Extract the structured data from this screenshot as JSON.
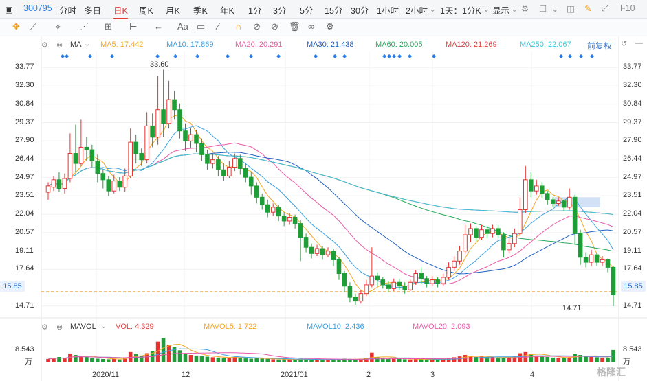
{
  "toolbar": {
    "code": "300795",
    "periods": [
      "分时",
      "多日",
      "日K",
      "周K",
      "月K",
      "季K",
      "年K",
      "1分",
      "3分",
      "5分",
      "15分",
      "30分",
      "1小时",
      "2小时"
    ],
    "active_period": "日K",
    "range_select": "1天：1分K",
    "display": "显示",
    "f10": "F10"
  },
  "drawtools": [
    "✥",
    "⟋",
    "⟡",
    "⋰",
    "⊞",
    "⊢",
    "←",
    "Aa",
    "▭",
    "∕",
    "∩",
    "⊘",
    "⊘",
    "🗑",
    "∞",
    "⚙"
  ],
  "ma_bar": {
    "label": "MA",
    "items": [
      {
        "text": "MA5: 17.442",
        "color": "#f5a623"
      },
      {
        "text": "MA10: 17.869",
        "color": "#3aa0e0"
      },
      {
        "text": "MA20: 20.291",
        "color": "#e85aa8"
      },
      {
        "text": "MA30: 21.438",
        "color": "#2060c0"
      },
      {
        "text": "MA60: 20.005",
        "color": "#27a85a"
      },
      {
        "text": "MA120: 21.269",
        "color": "#e04040"
      },
      {
        "text": "MA250: 22.067",
        "color": "#38c8e0"
      }
    ],
    "adjust": "前复权"
  },
  "price_axis": {
    "ticks": [
      "33.77",
      "32.30",
      "30.84",
      "29.37",
      "27.90",
      "26.44",
      "24.97",
      "23.51",
      "22.04",
      "20.57",
      "19.11",
      "17.64",
      "15.85",
      "14.71"
    ],
    "current": "15.85",
    "high_label": "33.60",
    "low_label": "14.71"
  },
  "date_axis": [
    "2020/11",
    "12",
    "2021/01",
    "2",
    "3",
    "4"
  ],
  "vol_bar": {
    "label": "MAVOL",
    "items": [
      {
        "text": "VOL: 4.329",
        "color": "#e04040"
      },
      {
        "text": "MAVOL5: 1.722",
        "color": "#f5a623"
      },
      {
        "text": "MAVOL10: 2.436",
        "color": "#3aa0e0"
      },
      {
        "text": "MAVOL20: 2.093",
        "color": "#e85aa8"
      }
    ],
    "max": "8.543",
    "unit": "万"
  },
  "watermark": "格隆汇",
  "chart_data": {
    "type": "candlestick",
    "ylim": [
      14.2,
      34.5
    ],
    "candles": [
      [
        23.8,
        24.3,
        23.2,
        24.6
      ],
      [
        24.2,
        24.8,
        23.9,
        25.1
      ],
      [
        24.8,
        24.1,
        23.8,
        25.4
      ],
      [
        24.1,
        24.9,
        23.7,
        25.3
      ],
      [
        24.9,
        26.9,
        24.6,
        28.5
      ],
      [
        26.9,
        26.1,
        25.4,
        29.2
      ],
      [
        26.1,
        27.4,
        25.9,
        29.6
      ],
      [
        27.4,
        27.2,
        26.3,
        28.2
      ],
      [
        27.2,
        26.3,
        25.8,
        27.6
      ],
      [
        26.3,
        25.3,
        24.6,
        26.8
      ],
      [
        25.3,
        24.8,
        24.1,
        25.6
      ],
      [
        24.8,
        23.9,
        23.5,
        25.1
      ],
      [
        23.9,
        24.7,
        23.7,
        25.2
      ],
      [
        24.7,
        24.2,
        23.9,
        25.0
      ],
      [
        24.2,
        25.1,
        23.8,
        25.7
      ],
      [
        25.1,
        27.8,
        24.9,
        28.9
      ],
      [
        27.8,
        26.9,
        26.1,
        28.4
      ],
      [
        26.9,
        26.4,
        25.9,
        27.3
      ],
      [
        26.4,
        29.1,
        26.1,
        30.2
      ],
      [
        29.1,
        28.2,
        27.4,
        30.1
      ],
      [
        28.2,
        30.4,
        27.6,
        33.1
      ],
      [
        30.4,
        29.3,
        28.2,
        33.6
      ],
      [
        29.3,
        31.2,
        28.9,
        32.7
      ],
      [
        31.2,
        30.4,
        29.6,
        31.9
      ],
      [
        30.4,
        28.7,
        28.1,
        30.9
      ],
      [
        28.7,
        27.9,
        27.1,
        29.3
      ],
      [
        27.9,
        28.4,
        27.3,
        28.9
      ],
      [
        28.4,
        27.7,
        27.0,
        28.8
      ],
      [
        27.7,
        26.8,
        26.3,
        28.1
      ],
      [
        26.8,
        26.1,
        25.6,
        27.2
      ],
      [
        26.1,
        26.4,
        25.7,
        26.9
      ],
      [
        26.4,
        25.6,
        25.1,
        26.7
      ],
      [
        25.6,
        25.1,
        24.7,
        26.1
      ],
      [
        25.1,
        25.8,
        24.9,
        26.3
      ],
      [
        25.8,
        26.5,
        25.5,
        26.9
      ],
      [
        26.5,
        25.7,
        25.2,
        26.8
      ],
      [
        25.7,
        25.0,
        24.6,
        26.1
      ],
      [
        25.0,
        24.3,
        23.6,
        25.4
      ],
      [
        24.3,
        23.4,
        22.9,
        24.6
      ],
      [
        23.4,
        22.8,
        22.4,
        23.7
      ],
      [
        22.8,
        22.2,
        21.8,
        23.2
      ],
      [
        22.2,
        22.6,
        21.9,
        22.9
      ],
      [
        22.6,
        21.9,
        21.5,
        22.8
      ],
      [
        21.9,
        21.5,
        21.1,
        22.2
      ],
      [
        21.5,
        21.8,
        21.2,
        22.1
      ],
      [
        21.8,
        21.3,
        20.9,
        22.0
      ],
      [
        21.3,
        20.2,
        18.3,
        21.6
      ],
      [
        20.2,
        19.4,
        19.0,
        20.5
      ],
      [
        19.4,
        18.9,
        18.5,
        19.7
      ],
      [
        18.9,
        19.3,
        18.7,
        19.6
      ],
      [
        19.3,
        18.8,
        18.4,
        19.5
      ],
      [
        18.8,
        19.1,
        18.6,
        19.4
      ],
      [
        19.1,
        18.4,
        17.9,
        19.3
      ],
      [
        18.4,
        17.3,
        16.8,
        18.6
      ],
      [
        17.3,
        16.3,
        15.8,
        17.5
      ],
      [
        16.3,
        15.4,
        15.0,
        16.6
      ],
      [
        15.4,
        15.1,
        14.8,
        15.7
      ],
      [
        15.1,
        15.7,
        14.9,
        16.0
      ],
      [
        15.7,
        16.4,
        15.5,
        16.8
      ],
      [
        16.4,
        17.1,
        16.2,
        19.4
      ],
      [
        17.1,
        16.8,
        16.3,
        17.4
      ],
      [
        16.8,
        16.4,
        16.1,
        17.0
      ],
      [
        16.4,
        16.1,
        15.8,
        16.7
      ],
      [
        16.1,
        16.6,
        15.9,
        16.9
      ],
      [
        16.6,
        16.3,
        16.0,
        16.9
      ],
      [
        16.3,
        16.0,
        15.7,
        16.6
      ],
      [
        16.0,
        16.6,
        15.9,
        16.8
      ],
      [
        16.6,
        17.3,
        16.4,
        17.6
      ],
      [
        17.3,
        16.9,
        16.5,
        17.8
      ],
      [
        16.9,
        16.5,
        16.2,
        17.1
      ],
      [
        16.5,
        16.8,
        16.3,
        17.1
      ],
      [
        16.8,
        16.5,
        16.2,
        17.0
      ],
      [
        16.5,
        17.0,
        16.3,
        17.3
      ],
      [
        17.0,
        17.8,
        16.8,
        18.2
      ],
      [
        17.8,
        18.3,
        17.5,
        18.7
      ],
      [
        18.3,
        19.1,
        18.0,
        19.5
      ],
      [
        19.1,
        20.4,
        18.9,
        21.2
      ],
      [
        20.4,
        20.9,
        19.8,
        21.3
      ],
      [
        20.9,
        20.2,
        19.9,
        21.1
      ],
      [
        20.2,
        20.8,
        20.0,
        21.2
      ],
      [
        20.8,
        20.5,
        20.1,
        21.1
      ],
      [
        20.5,
        20.9,
        20.2,
        21.2
      ],
      [
        20.9,
        20.4,
        20.1,
        21.2
      ],
      [
        20.4,
        19.2,
        18.6,
        20.6
      ],
      [
        19.2,
        19.7,
        18.9,
        20.1
      ],
      [
        19.7,
        20.5,
        19.4,
        20.9
      ],
      [
        20.5,
        22.4,
        20.3,
        23.4
      ],
      [
        22.4,
        24.8,
        22.1,
        25.9
      ],
      [
        24.8,
        23.9,
        23.4,
        25.4
      ],
      [
        23.9,
        24.3,
        23.6,
        24.8
      ],
      [
        24.3,
        23.7,
        23.3,
        24.6
      ],
      [
        23.7,
        23.2,
        22.8,
        23.9
      ],
      [
        23.2,
        22.9,
        22.6,
        23.4
      ],
      [
        22.9,
        23.1,
        22.7,
        23.4
      ],
      [
        23.1,
        22.6,
        22.3,
        23.2
      ],
      [
        22.6,
        23.4,
        22.4,
        24.1
      ],
      [
        23.4,
        20.5,
        19.6,
        23.6
      ],
      [
        20.5,
        18.6,
        18.0,
        20.8
      ],
      [
        18.6,
        18.2,
        17.8,
        19.0
      ],
      [
        18.2,
        18.8,
        17.9,
        19.2
      ],
      [
        18.8,
        18.2,
        17.9,
        19.0
      ],
      [
        18.2,
        18.4,
        17.9,
        18.7
      ],
      [
        18.4,
        17.8,
        17.4,
        18.5
      ],
      [
        17.8,
        15.6,
        14.7,
        17.9
      ]
    ],
    "volumes": [
      1.2,
      1.5,
      1.9,
      1.4,
      3.1,
      2.6,
      2.2,
      1.9,
      1.5,
      1.3,
      1.2,
      1.1,
      1.3,
      1.0,
      1.6,
      3.6,
      2.9,
      2.4,
      3.2,
      3.8,
      7.2,
      8.5,
      6.1,
      5.4,
      4.2,
      3.1,
      2.6,
      2.4,
      2.2,
      2.0,
      1.8,
      1.7,
      1.5,
      1.6,
      1.9,
      1.6,
      1.4,
      1.3,
      1.5,
      1.3,
      1.2,
      1.1,
      1.0,
      1.1,
      1.0,
      0.9,
      1.3,
      1.1,
      1.0,
      0.9,
      0.8,
      0.9,
      1.0,
      1.1,
      1.3,
      1.2,
      1.0,
      1.3,
      1.6,
      3.4,
      1.8,
      1.5,
      1.3,
      1.4,
      1.2,
      1.1,
      1.0,
      1.2,
      1.1,
      1.0,
      0.9,
      1.0,
      1.2,
      1.5,
      1.8,
      2.1,
      2.6,
      2.2,
      1.9,
      2.0,
      1.8,
      1.9,
      1.7,
      1.6,
      1.8,
      2.1,
      3.2,
      3.6,
      2.9,
      2.4,
      2.1,
      1.9,
      1.7,
      1.6,
      1.5,
      1.8,
      2.9,
      2.6,
      2.2,
      1.9,
      1.8,
      1.7,
      1.6,
      4.3
    ]
  }
}
